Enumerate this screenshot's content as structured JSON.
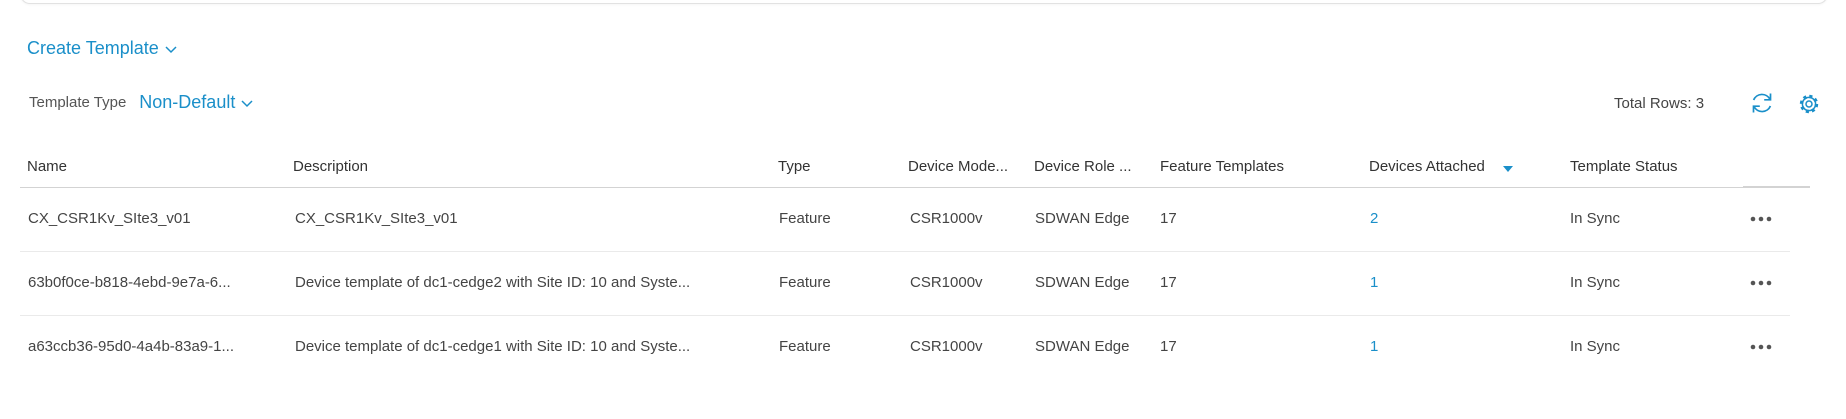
{
  "create_template": {
    "label": "Create Template"
  },
  "filter": {
    "label": "Template Type",
    "value": "Non-Default"
  },
  "total_rows": "Total Rows: 3",
  "table": {
    "columns": [
      "Name",
      "Description",
      "Type",
      "Device Mode...",
      "Device Role ...",
      "Feature Templates",
      "Devices Attached",
      "Template Status"
    ],
    "sorted_column": "Devices Attached",
    "rows": [
      {
        "name": "CX_CSR1Kv_SIte3_v01",
        "description": "CX_CSR1Kv_SIte3_v01",
        "type": "Feature",
        "device_model": "CSR1000v",
        "device_role": "SDWAN Edge",
        "feature_templates": "17",
        "devices_attached": "2",
        "status": "In Sync"
      },
      {
        "name": "63b0f0ce-b818-4ebd-9e7a-6...",
        "description": "Device template of dc1-cedge2 with Site ID: 10 and Syste...",
        "type": "Feature",
        "device_model": "CSR1000v",
        "device_role": "SDWAN Edge",
        "feature_templates": "17",
        "devices_attached": "1",
        "status": "In Sync"
      },
      {
        "name": "a63ccb36-95d0-4a4b-83a9-1...",
        "description": "Device template of dc1-cedge1 with Site ID: 10 and Syste...",
        "type": "Feature",
        "device_model": "CSR1000v",
        "device_role": "SDWAN Edge",
        "feature_templates": "17",
        "devices_attached": "1",
        "status": "In Sync"
      }
    ]
  },
  "icons": {
    "refresh": "refresh-icon",
    "settings": "gear-icon",
    "more": "more-horizontal-icon",
    "chevron": "chevron-down-icon",
    "sort": "sort-descending-icon"
  },
  "colors": {
    "accent": "#1a8fc9",
    "text": "#333333",
    "border": "#d3d3d3"
  }
}
